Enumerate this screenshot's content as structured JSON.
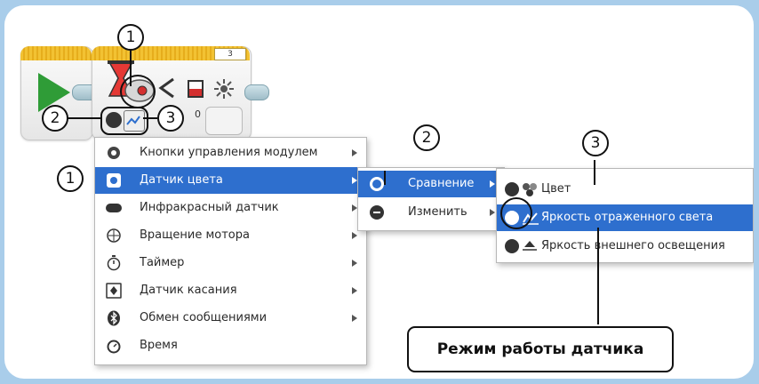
{
  "block": {
    "port": "3",
    "gear_zero": "0"
  },
  "callouts": {
    "c1": "1",
    "c2": "2",
    "c3": "3"
  },
  "menu1": {
    "items": [
      {
        "label": "Кнопки управления модулем",
        "icon": "brick-buttons-icon",
        "has_sub": true
      },
      {
        "label": "Датчик цвета",
        "icon": "color-sensor-icon",
        "has_sub": true,
        "highlighted": true
      },
      {
        "label": "Инфракрасный датчик",
        "icon": "infrared-sensor-icon",
        "has_sub": true
      },
      {
        "label": "Вращение мотора",
        "icon": "motor-rotation-icon",
        "has_sub": true
      },
      {
        "label": "Таймер",
        "icon": "timer-icon",
        "has_sub": true
      },
      {
        "label": "Датчик касания",
        "icon": "touch-sensor-icon",
        "has_sub": true
      },
      {
        "label": "Обмен сообщениями",
        "icon": "bluetooth-icon",
        "has_sub": true
      },
      {
        "label": "Время",
        "icon": "clock-icon",
        "has_sub": false
      }
    ]
  },
  "menu2": {
    "items": [
      {
        "label": "Сравнение",
        "icon": "compare-icon",
        "highlighted": true
      },
      {
        "label": "Изменить",
        "icon": "change-icon",
        "highlighted": false
      }
    ]
  },
  "menu3": {
    "items": [
      {
        "label": "Цвет",
        "icon": "color-mode-icon",
        "highlighted": false
      },
      {
        "label": "Яркость отраженного света",
        "icon": "reflected-light-icon",
        "highlighted": true
      },
      {
        "label": "Яркость внешнего освещения",
        "icon": "ambient-light-icon",
        "highlighted": false
      }
    ]
  },
  "annotation": {
    "label": "Режим работы датчика"
  },
  "colors": {
    "highlight": "#2e6fce",
    "block_tab": "#f2c233",
    "play": "#2f9c37",
    "background": "#a9cdea"
  }
}
